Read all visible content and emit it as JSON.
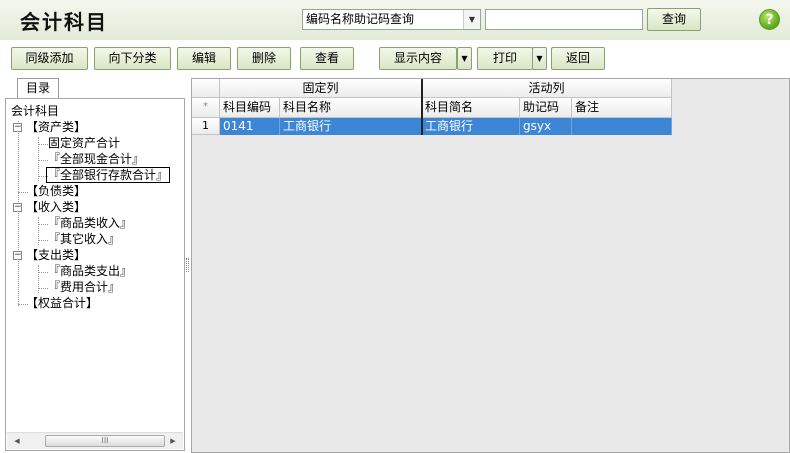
{
  "header": {
    "title": "会计科目",
    "search_mode": "编码名称助记码查询",
    "search_value": "",
    "search_button": "查询",
    "help_label": "?"
  },
  "toolbar": {
    "add_sibling": "同级添加",
    "add_child": "向下分类",
    "edit": "编辑",
    "delete": "删除",
    "view": "查看",
    "display_content": "显示内容",
    "print": "打印",
    "back": "返回"
  },
  "left_panel": {
    "tab_label": "目录",
    "tree": {
      "root": "会计科目",
      "assets": "【资产类】",
      "fixed_assets_total": "固定资产合计",
      "cash_total": "『全部现金合计』",
      "bank_deposit_total": "『全部银行存款合计』",
      "liabilities": "【负债类】",
      "income": "【收入类】",
      "goods_income": "『商品类收入』",
      "other_income": "『其它收入』",
      "expenses": "【支出类】",
      "goods_expense": "『商品类支出』",
      "expense_total": "『费用合计』",
      "equity_total": "【权益合计】"
    },
    "scrollbar_grip": "III"
  },
  "grid": {
    "group_headers": {
      "frozen": "固定列",
      "active": "活动列"
    },
    "row_marker_header": "*",
    "columns": [
      "科目编码",
      "科目名称",
      "科目简名",
      "助记码",
      "备注"
    ],
    "rows": [
      {
        "index": "1",
        "code": "0141",
        "name": "工商银行",
        "short_name": "工商银行",
        "mnemonic": "gsyx",
        "note": ""
      }
    ]
  }
}
